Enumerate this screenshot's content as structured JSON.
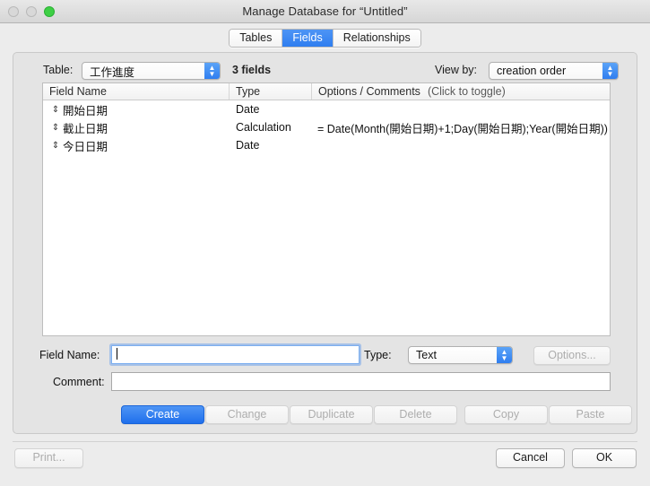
{
  "window": {
    "title": "Manage Database for “Untitled”",
    "traffic_lights": [
      "close-button",
      "minimize-button",
      "zoom-button"
    ]
  },
  "tabs": [
    {
      "label": "Tables",
      "active": false
    },
    {
      "label": "Fields",
      "active": true
    },
    {
      "label": "Relationships",
      "active": false
    }
  ],
  "toolbar": {
    "table_label": "Table:",
    "table_value": "工作進度",
    "fields_count": "3 fields",
    "viewby_label": "View by:",
    "viewby_value": "creation order"
  },
  "list": {
    "headers": {
      "field_name": "Field Name",
      "type": "Type",
      "options": "Options / Comments",
      "options_hint": "(Click to toggle)"
    },
    "rows": [
      {
        "handle": "⇕",
        "name": "開始日期",
        "type": "Date",
        "options": ""
      },
      {
        "handle": "⇕",
        "name": "截止日期",
        "type": "Calculation",
        "options": "= Date(Month(開始日期)+1;Day(開始日期);Year(開始日期))"
      },
      {
        "handle": "⇕",
        "name": "今日日期",
        "type": "Date",
        "options": ""
      }
    ]
  },
  "form": {
    "field_name_label": "Field Name:",
    "field_name_value": "",
    "comment_label": "Comment:",
    "comment_value": "",
    "type_label": "Type:",
    "type_value": "Text",
    "options_button": "Options..."
  },
  "actions": {
    "create": "Create",
    "change": "Change",
    "duplicate": "Duplicate",
    "delete": "Delete",
    "copy": "Copy",
    "paste": "Paste"
  },
  "footer": {
    "print": "Print...",
    "cancel": "Cancel",
    "ok": "OK"
  },
  "colors": {
    "accent_blue": "#2f7ef0",
    "window_bg": "#ececec",
    "panel_bg": "#e4e4e4",
    "list_bg": "#ffffff",
    "zoom_green": "#3ecf45"
  }
}
